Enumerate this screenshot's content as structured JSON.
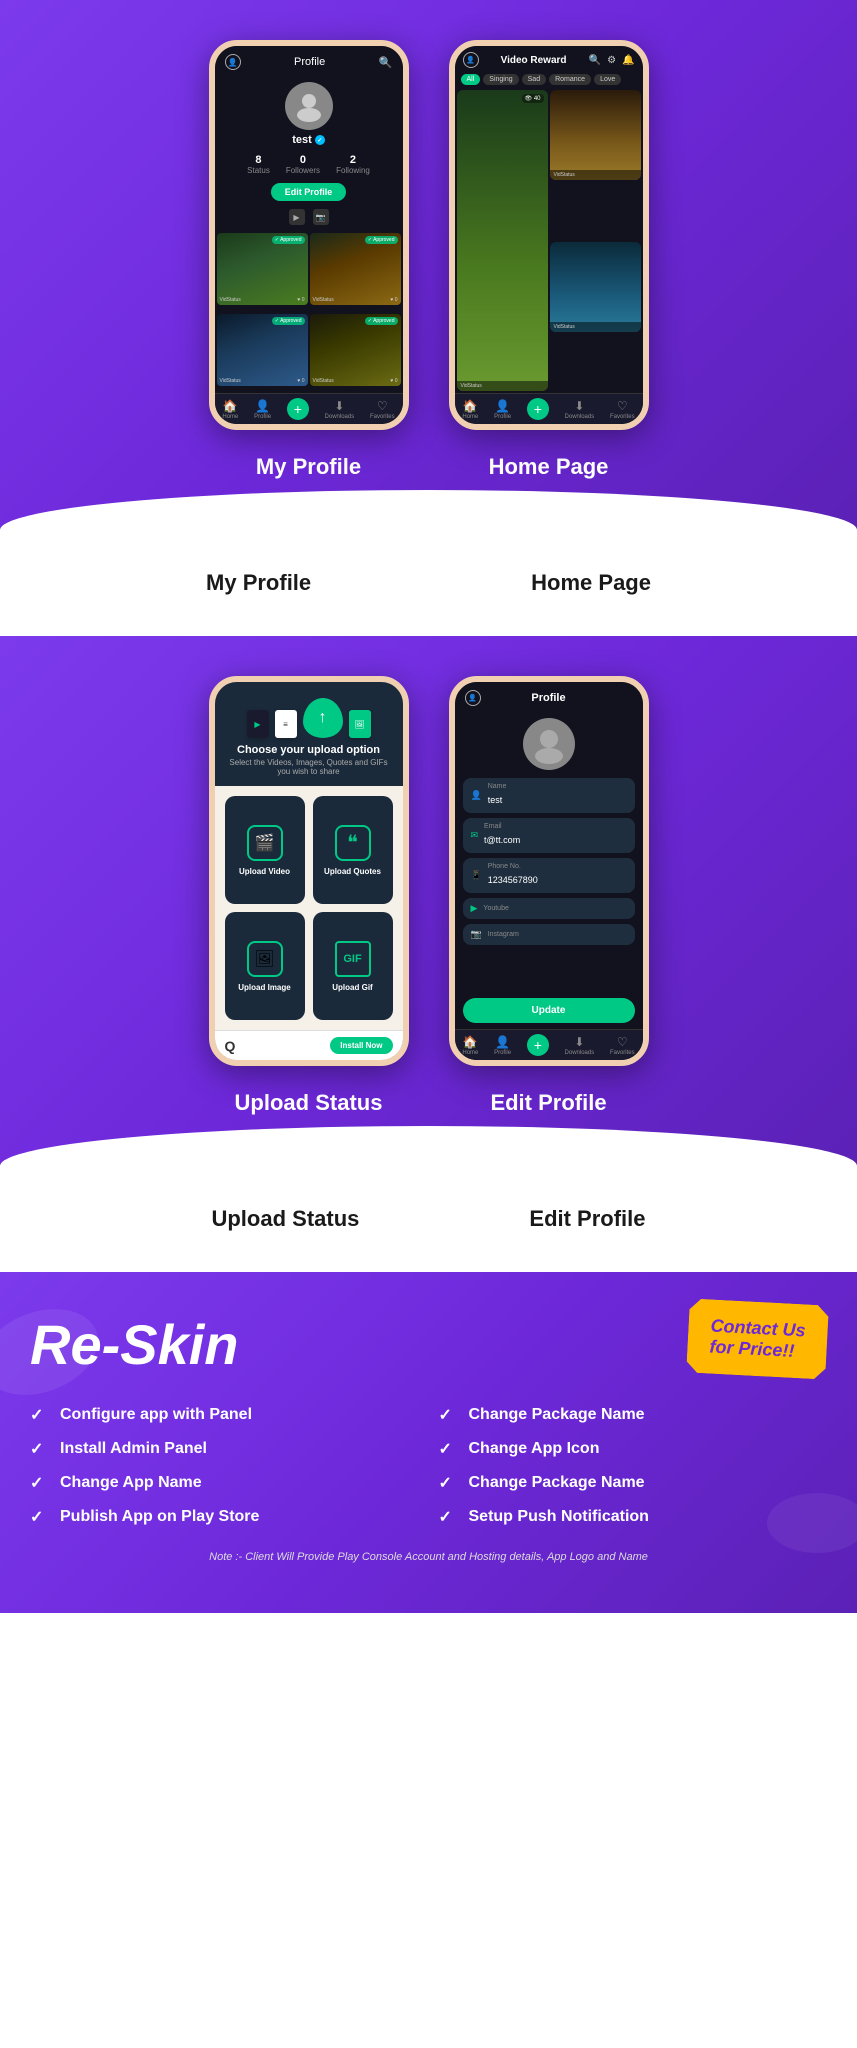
{
  "section1": {
    "leftPhone": {
      "label": "My Profile",
      "topbar": "Profile",
      "username": "test",
      "stats": [
        {
          "num": "8",
          "label": "Status"
        },
        {
          "num": "0",
          "label": "Followers"
        },
        {
          "num": "2",
          "label": "Following"
        }
      ],
      "editBtn": "Edit Profile",
      "nav": [
        "Home",
        "Profile",
        "+",
        "Downloads",
        "Favorites"
      ]
    },
    "rightPhone": {
      "label": "Home Page",
      "topbar": "Video Reward",
      "categories": [
        "All",
        "Singing",
        "Sad",
        "Romance",
        "Love"
      ],
      "nav": [
        "Home",
        "Profile",
        "+",
        "Downloads",
        "Favorites"
      ]
    }
  },
  "section2": {
    "leftPhone": {
      "label": "Upload Status",
      "uploadTitle": "Choose your upload option",
      "uploadSubtitle": "Select the Videos, Images, Quotes and GIFs you wish to share",
      "options": [
        {
          "label": "Upload Video",
          "icon": "🎬"
        },
        {
          "label": "Upload Quotes",
          "icon": "❝"
        },
        {
          "label": "Upload Image",
          "icon": "🖼"
        },
        {
          "label": "Upload Gif",
          "icon": "GIF"
        }
      ],
      "installBtn": "Install Now"
    },
    "rightPhone": {
      "label": "Edit Profile",
      "topbar": "Profile",
      "fields": [
        {
          "label": "Name",
          "value": "test",
          "icon": "👤"
        },
        {
          "label": "Email",
          "value": "t@tt.com",
          "icon": "✉"
        },
        {
          "label": "Phone No.",
          "value": "1234567890",
          "icon": "📱"
        },
        {
          "label": "Youtube",
          "value": "",
          "icon": "▶"
        },
        {
          "label": "Instagram",
          "value": "",
          "icon": "📷"
        }
      ],
      "updateBtn": "Update",
      "nav": [
        "Home",
        "Profile",
        "+",
        "Downloads",
        "Favorites"
      ]
    }
  },
  "reskin": {
    "title": "Re-Skin",
    "contactLine1": "Contact Us",
    "contactLine2": "for Price!!",
    "features": [
      {
        "text": "Configure app with Panel"
      },
      {
        "text": "Change Package Name"
      },
      {
        "text": "Install Admin Panel"
      },
      {
        "text": "Change App Icon"
      },
      {
        "text": "Change App Name"
      },
      {
        "text": "Change Package Name"
      },
      {
        "text": "Publish App on Play Store"
      },
      {
        "text": "Setup Push Notification"
      }
    ],
    "note": "Note :- Client Will Provide Play Console Account and Hosting details, App Logo and Name"
  }
}
